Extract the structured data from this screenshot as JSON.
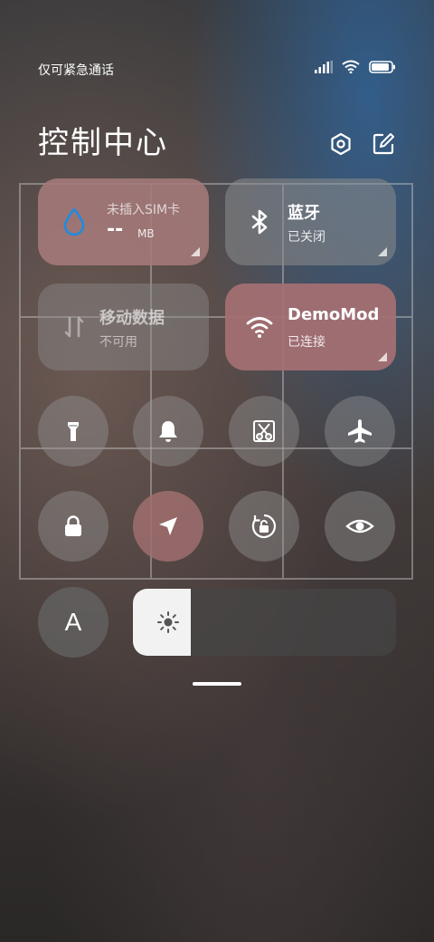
{
  "status_bar": {
    "carrier": "仅可紧急通话",
    "battery_level": 0.9
  },
  "header": {
    "title": "控制中心",
    "settings_icon": "gear-icon",
    "edit_icon": "edit-icon"
  },
  "tiles": [
    {
      "id": "data-usage",
      "name": "未插入SIM卡",
      "value": "--",
      "unit": "MB",
      "icon": "water-drop-icon",
      "state": "active"
    },
    {
      "id": "bluetooth",
      "name": "蓝牙",
      "status": "已关闭",
      "icon": "bluetooth-icon",
      "state": "off"
    },
    {
      "id": "mobile-data",
      "name": "移动数据",
      "status": "不可用",
      "icon": "mobile-data-icon",
      "state": "disabled"
    },
    {
      "id": "wifi",
      "name": "DemoMod",
      "status": "已连接",
      "icon": "wifi-icon",
      "state": "on"
    }
  ],
  "toggles": [
    {
      "id": "flashlight",
      "icon": "flashlight-icon",
      "active": false
    },
    {
      "id": "silent",
      "icon": "bell-icon",
      "active": false
    },
    {
      "id": "screenshot",
      "icon": "scissors-icon",
      "active": false
    },
    {
      "id": "airplane",
      "icon": "airplane-icon",
      "active": false
    },
    {
      "id": "lock-screen",
      "icon": "lock-icon",
      "active": false
    },
    {
      "id": "location",
      "icon": "location-arrow-icon",
      "active": true
    },
    {
      "id": "auto-rotate",
      "icon": "rotation-lock-icon",
      "active": false
    },
    {
      "id": "reading-mode",
      "icon": "eye-icon",
      "active": false
    }
  ],
  "auto_brightness": {
    "label": "A"
  },
  "brightness": {
    "level": 0.22,
    "icon": "sun-icon"
  },
  "colors": {
    "tile_active": "#a57a7a",
    "tile_inactive": "#8a8a8a",
    "accent_drop": "#1e8be0"
  }
}
